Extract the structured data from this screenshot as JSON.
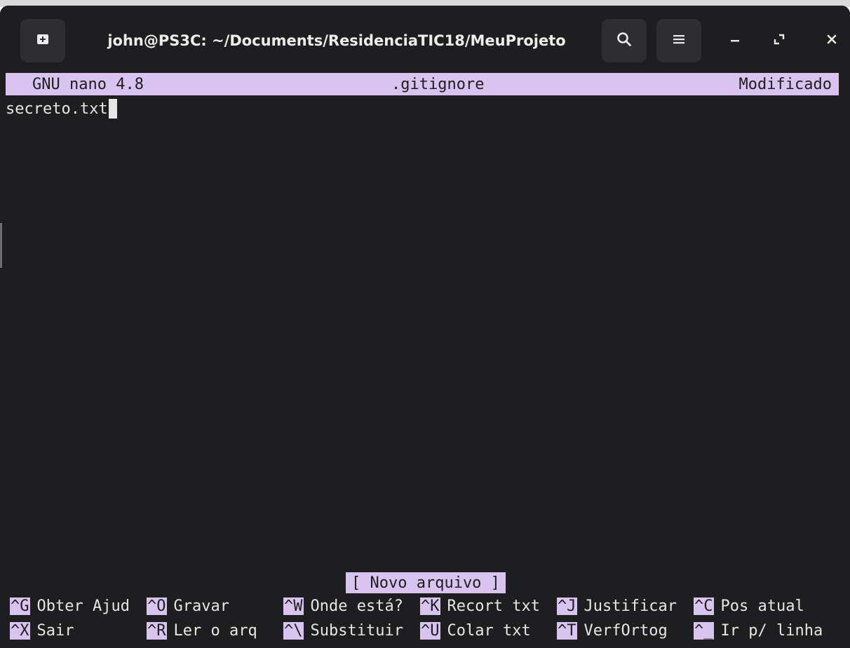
{
  "window": {
    "title": "john@PS3C: ~/Documents/ResidenciaTIC18/MeuProjeto",
    "buttons": [
      "new-tab-icon",
      "search-icon",
      "menu-icon",
      "minimize-icon",
      "maximize-icon",
      "close-icon"
    ]
  },
  "nano": {
    "version": "GNU nano 4.8",
    "filename": ".gitignore",
    "state": "Modificado",
    "lines": [
      "secreto.txt"
    ],
    "status": "[ Novo arquivo ]"
  },
  "shortcuts": {
    "row1": [
      {
        "key": "^G",
        "label": "Obter Ajud"
      },
      {
        "key": "^O",
        "label": "Gravar"
      },
      {
        "key": "^W",
        "label": "Onde está?"
      },
      {
        "key": "^K",
        "label": "Recort txt"
      },
      {
        "key": "^J",
        "label": "Justificar"
      },
      {
        "key": "^C",
        "label": "Pos atual"
      }
    ],
    "row2": [
      {
        "key": "^X",
        "label": "Sair"
      },
      {
        "key": "^R",
        "label": "Ler o arq"
      },
      {
        "key": "^\\",
        "label": "Substituir"
      },
      {
        "key": "^U",
        "label": "Colar txt"
      },
      {
        "key": "^T",
        "label": "VerfOrtog"
      },
      {
        "key": "^_",
        "label": "Ir p/ linha"
      }
    ]
  },
  "colors": {
    "background": "#1e1e21",
    "highlight": "#d9c3ef",
    "text": "#e6e6e6"
  }
}
